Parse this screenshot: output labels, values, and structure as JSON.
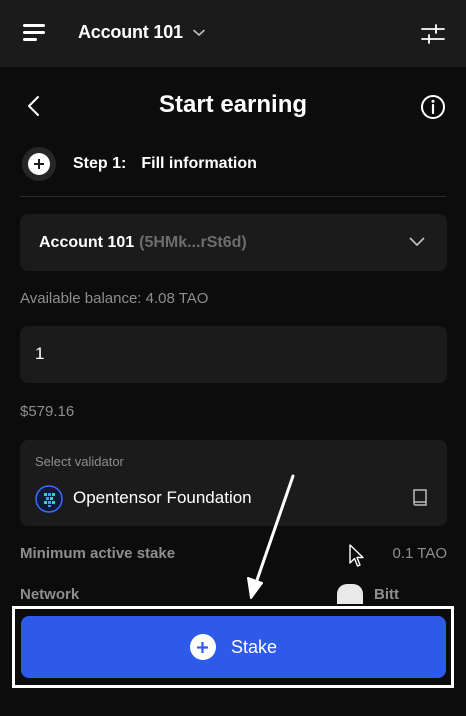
{
  "header": {
    "account_name": "Account 101",
    "icons": {
      "menu": "hamburger-menu-icon",
      "chevron": "chevron-down-icon",
      "settings": "sliders-icon"
    }
  },
  "page": {
    "title": "Start earning",
    "icons": {
      "back": "chevron-left-icon",
      "info": "info-icon"
    }
  },
  "step": {
    "label": "Step 1:",
    "text": "Fill information"
  },
  "account_select": {
    "name": "Account 101",
    "address": "(5HMk...rSt6d)"
  },
  "balance_text": "Available balance: 4.08 TAO",
  "amount_input": {
    "value": "1"
  },
  "usd_value": "$579.16",
  "validator": {
    "label": "Select validator",
    "name": "Opentensor Foundation",
    "icons": {
      "logo": "opentensor-logo-icon",
      "book": "book-icon"
    }
  },
  "stats": [
    {
      "key": "Minimum active stake",
      "value": "0.1 TAO"
    },
    {
      "key": "Network",
      "value": "Bitt"
    }
  ],
  "stake_button": {
    "label": "Stake"
  },
  "colors": {
    "background": "#0c0c0c",
    "card": "#1b1b1b",
    "accent": "#2d5ae8",
    "muted_text": "#8e8e8e"
  }
}
